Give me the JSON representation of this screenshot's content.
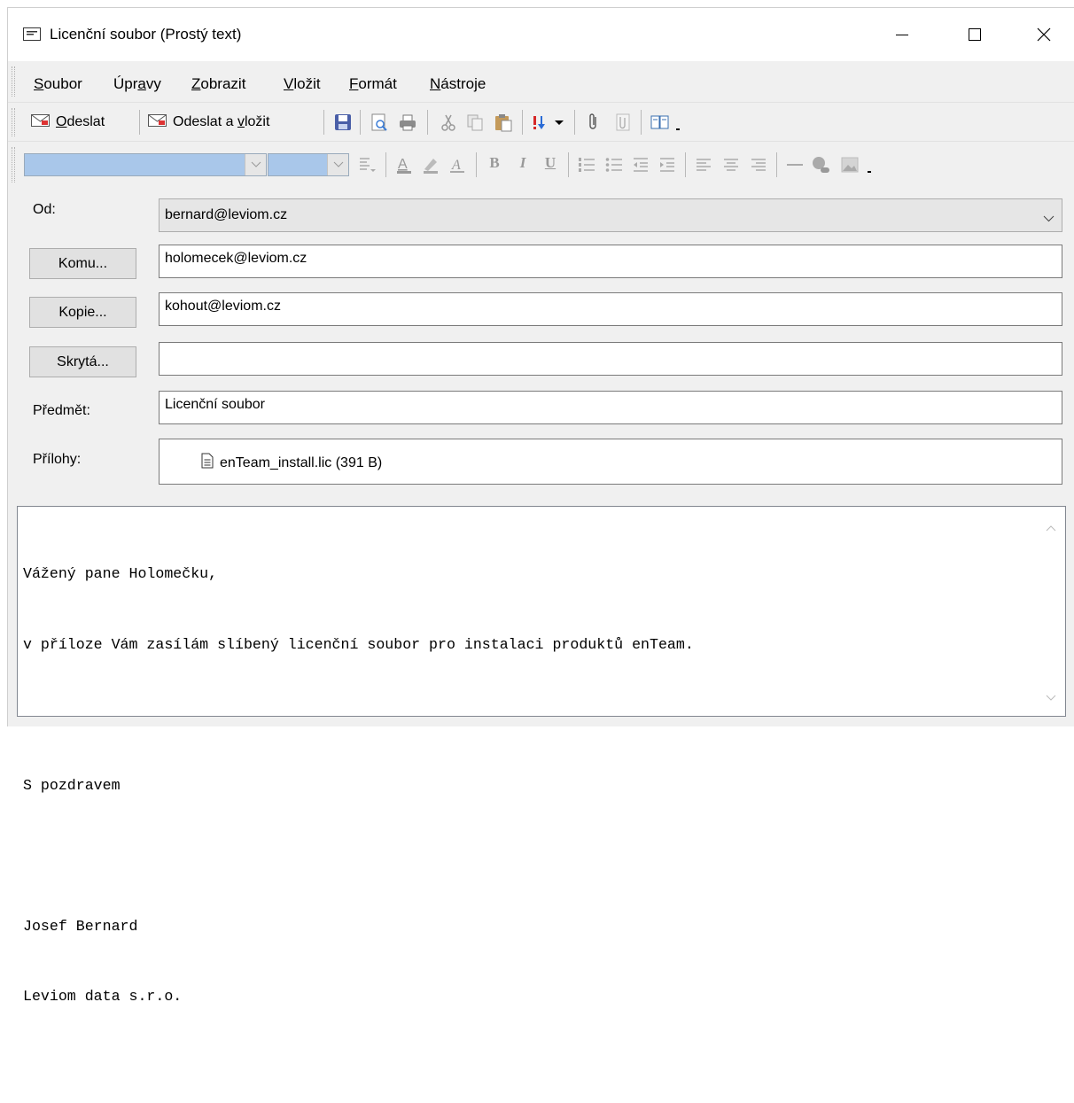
{
  "window": {
    "title": "Licenční soubor (Prostý text)",
    "icons": [
      "message-icon",
      "minimize-icon",
      "maximize-icon",
      "close-icon"
    ]
  },
  "menu": [
    {
      "pre": "",
      "key": "S",
      "post": "oubor"
    },
    {
      "pre": "Úpr",
      "key": "a",
      "post": "vy"
    },
    {
      "pre": "",
      "key": "Z",
      "post": "obrazit"
    },
    {
      "pre": "",
      "key": "V",
      "post": "ložit"
    },
    {
      "pre": "",
      "key": "F",
      "post": "ormát"
    },
    {
      "pre": "",
      "key": "N",
      "post": "ástroje"
    }
  ],
  "toolbar": {
    "send": {
      "pre": "",
      "key": "O",
      "post": "deslat"
    },
    "send_insert": {
      "pre": "Odeslat a ",
      "key": "v",
      "post": "ložit"
    },
    "icons": [
      "save-icon",
      "print-preview-icon",
      "print-icon",
      "cut-icon",
      "copy-icon",
      "paste-icon",
      "priority-icon",
      "attach-icon",
      "attach-inline-icon",
      "address-book-icon"
    ]
  },
  "format_toolbar": {
    "icons": [
      "paragraph-style-icon",
      "font-color-icon",
      "highlight-icon",
      "clear-format-icon",
      "bold-icon",
      "italic-icon",
      "underline-icon",
      "numbered-list-icon",
      "bullet-list-icon",
      "outdent-icon",
      "indent-icon",
      "align-left-icon",
      "align-center-icon",
      "align-right-icon",
      "horizontal-line-icon",
      "link-icon",
      "image-icon"
    ],
    "bold": "B",
    "italic": "I",
    "underline": "U"
  },
  "fields": {
    "from_label": "Od:",
    "from_value": "bernard@leviom.cz",
    "to_button": "Komu...",
    "to_value": "holomecek@leviom.cz",
    "cc_button": "Kopie...",
    "cc_value": "kohout@leviom.cz",
    "bcc_button": "Skrytá...",
    "bcc_value": "",
    "subject_label": "Předmět:",
    "subject_value": "Licenční soubor",
    "attachments_label": "Přílohy:",
    "attachment": "enTeam_install.lic (391 B)"
  },
  "body": {
    "lines": [
      "Vážený pane Holomečku,",
      "v příloze Vám zasílám slíbený licenční soubor pro instalaci produktů enTeam.",
      "",
      "S pozdravem",
      "",
      "Josef Bernard",
      "Leviom data s.r.o."
    ]
  },
  "colors": {
    "window_bg": "#f0f0f0",
    "combo_highlight": "#a9c7ea",
    "save_icon": "#4a5fa8",
    "priority_high": "#d62828",
    "priority_low": "#2a6bd6"
  }
}
